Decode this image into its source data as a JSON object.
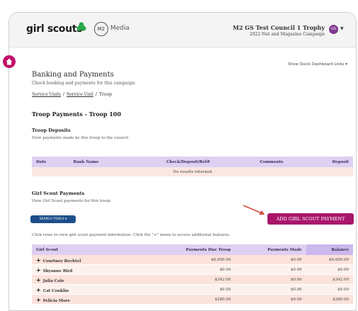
{
  "header": {
    "logo_text": "girl scouts",
    "m2_badge": "M2",
    "media_label": "Media",
    "council_name": "M2 GS Test Council 1 Trophy",
    "campaign_name": "2022 Nut and Magazine Campaign",
    "avatar_initials": "GS"
  },
  "quick_links": "Show Quick Dashboard Links ▾",
  "page": {
    "title": "Banking and Payments",
    "subtitle": "Check banking and payments for this campaign.",
    "breadcrumb": [
      "Service Units",
      "Service Unit",
      "Troop"
    ],
    "troop_title": "Troop Payments - Troop 100"
  },
  "deposits": {
    "title": "Troop Deposits",
    "subtitle": "View payments made by this troop to the council",
    "columns": [
      "Date",
      "Bank Name",
      "Check/Deposit/Ref#",
      "Comments",
      "Deposit"
    ],
    "empty_text": "No results returned"
  },
  "gs_payments": {
    "title": "Girl Scout Payments",
    "subtitle": "View Girl Scout payments for this troop.",
    "search_label": "SEARCH TOOLS ▾",
    "add_label": "ADD GIRL SCOUT PAYMENT",
    "hint": "Click rows to view girl scout payment information. Click the \"+\" menu to access additional features.",
    "columns": [
      "Girl Scout",
      "Payments Due Troop",
      "Payments Made",
      "Balance"
    ],
    "rows": [
      {
        "name": "Courtney Bechtel",
        "due": "$6,000.00",
        "made": "$0.00",
        "balance": "$6,000.00"
      },
      {
        "name": "Shyanne Bird",
        "due": "$0.00",
        "made": "$0.00",
        "balance": "$0.00"
      },
      {
        "name": "Julia Cole",
        "due": "$342.00",
        "made": "$0.00",
        "balance": "$342.00"
      },
      {
        "name": "Cat Conklin",
        "due": "$0.00",
        "made": "$0.00",
        "balance": "$0.00"
      },
      {
        "name": "Felicia More",
        "due": "$280.00",
        "made": "$0.00",
        "balance": "$280.00"
      }
    ]
  },
  "colors": {
    "brand_magenta": "#a8166a",
    "brand_blue": "#1c4f8a",
    "table_header": "#ded0f2",
    "row_tint": "#fbe3dc"
  },
  "icons": [
    "trefoil-icon",
    "home-icon",
    "chevron-down-icon",
    "plus-icon",
    "arrow-icon"
  ]
}
